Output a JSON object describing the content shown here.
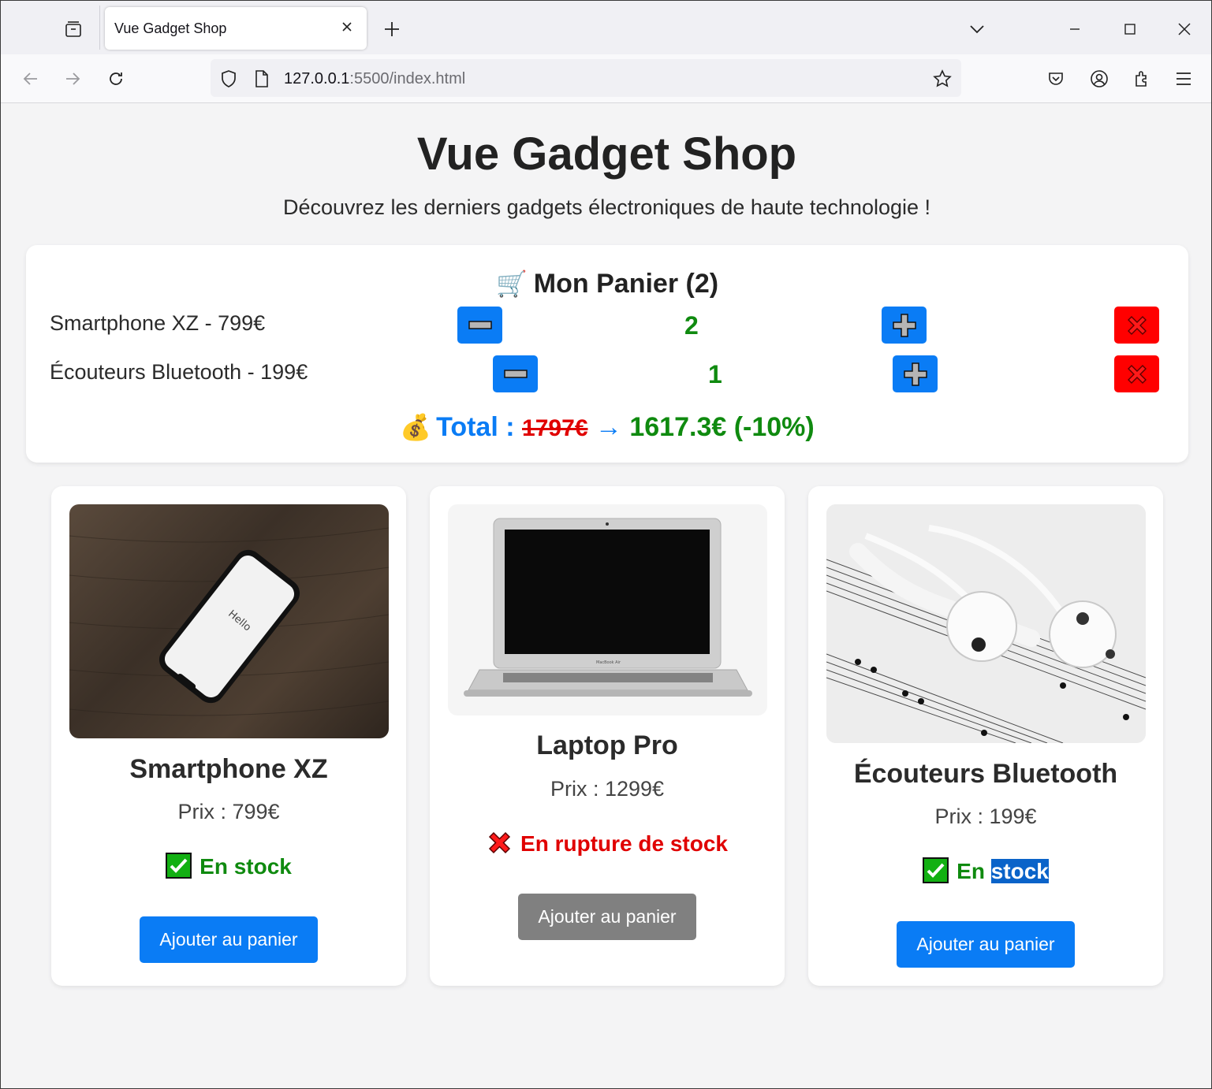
{
  "browser": {
    "tab_title": "Vue Gadget Shop",
    "url_host": "127.0.0.1",
    "url_rest": ":5500/index.html"
  },
  "page": {
    "title": "Vue Gadget Shop",
    "subtitle": "Découvrez les derniers gadgets électroniques de haute technologie !"
  },
  "cart": {
    "emoji": "🛒",
    "title": "Mon Panier (2)",
    "items": [
      {
        "label": "Smartphone XZ - 799€",
        "quantity": "2"
      },
      {
        "label": "Écouteurs Bluetooth - 199€",
        "quantity": "1"
      }
    ],
    "total_emoji": "💰",
    "total_label": "Total :",
    "total_original": "1797€",
    "total_arrow": "→",
    "total_discounted": "1617.3€ (-10%)"
  },
  "products": [
    {
      "name": "Smartphone XZ",
      "price": "Prix : 799€",
      "stock_text": "En stock",
      "in_stock": true,
      "button": "Ajouter au panier"
    },
    {
      "name": "Laptop Pro",
      "price": "Prix : 1299€",
      "stock_text": "En rupture de stock",
      "in_stock": false,
      "button": "Ajouter au panier"
    },
    {
      "name": "Écouteurs Bluetooth",
      "price": "Prix : 199€",
      "stock_text_a": "En",
      "stock_text_b": "stock",
      "in_stock": true,
      "button": "Ajouter au panier"
    }
  ],
  "colors": {
    "accent": "#0a7cf5",
    "in_stock": "#0f8a0f",
    "out_of_stock": "#e00000",
    "remove": "#ff0000",
    "disabled": "#808080"
  }
}
